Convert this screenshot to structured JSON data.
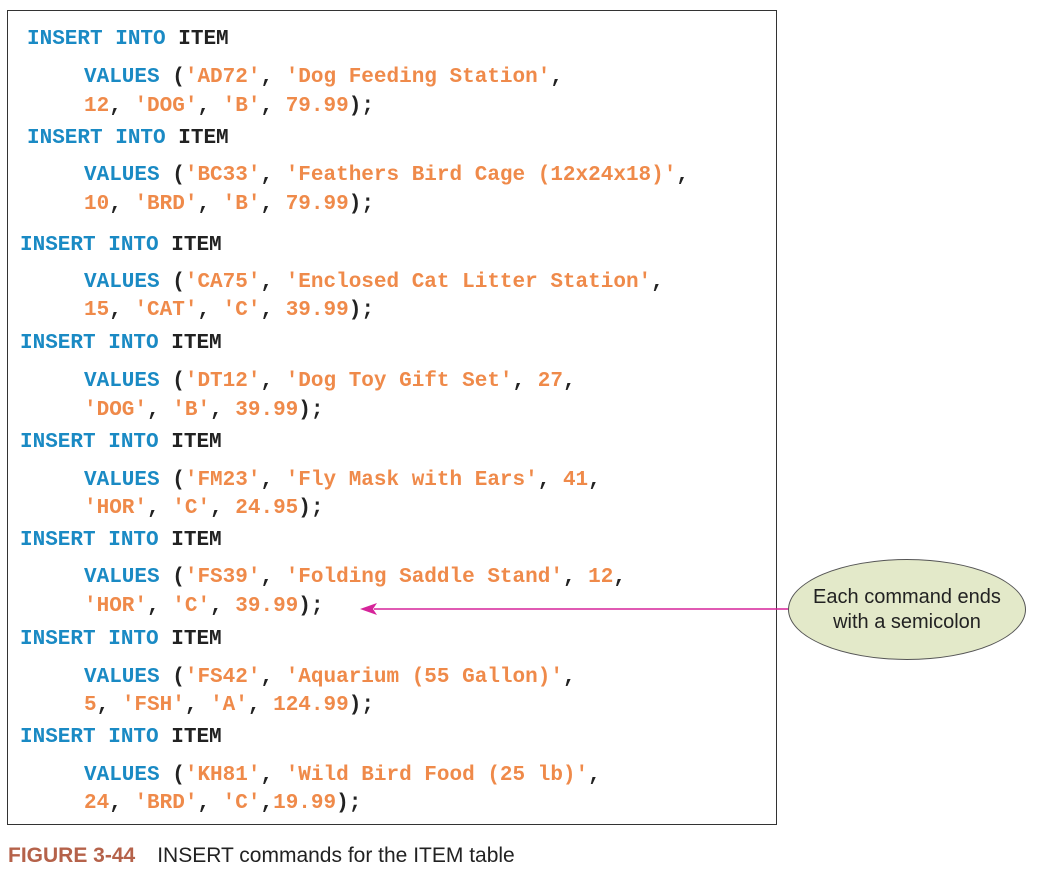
{
  "lines": [
    [
      [
        "kw",
        "INSERT INTO"
      ],
      [
        "pn",
        " "
      ],
      [
        "tbl",
        "ITEM"
      ]
    ],
    [
      [
        "kw",
        "VALUES"
      ],
      [
        "pn",
        " ("
      ],
      [
        "val",
        "'AD72'"
      ],
      [
        "pn",
        ", "
      ],
      [
        "val",
        "'Dog Feeding Station'"
      ],
      [
        "pn",
        ","
      ]
    ],
    [
      [
        "val",
        "12"
      ],
      [
        "pn",
        ", "
      ],
      [
        "val",
        "'DOG'"
      ],
      [
        "pn",
        ", "
      ],
      [
        "val",
        "'B'"
      ],
      [
        "pn",
        ", "
      ],
      [
        "val",
        "79.99"
      ],
      [
        "pn",
        ");"
      ]
    ],
    [
      [
        "kw",
        "INSERT INTO"
      ],
      [
        "pn",
        " "
      ],
      [
        "tbl",
        "ITEM"
      ]
    ],
    [
      [
        "kw",
        "VALUES"
      ],
      [
        "pn",
        " ("
      ],
      [
        "val",
        "'BC33'"
      ],
      [
        "pn",
        ", "
      ],
      [
        "val",
        "'Feathers Bird Cage (12x24x18)'"
      ],
      [
        "pn",
        ","
      ]
    ],
    [
      [
        "val",
        "10"
      ],
      [
        "pn",
        ", "
      ],
      [
        "val",
        "'BRD'"
      ],
      [
        "pn",
        ", "
      ],
      [
        "val",
        "'B'"
      ],
      [
        "pn",
        ", "
      ],
      [
        "val",
        "79.99"
      ],
      [
        "pn",
        ");"
      ]
    ],
    [
      [
        "kw",
        "INSERT INTO"
      ],
      [
        "pn",
        " "
      ],
      [
        "tbl",
        "ITEM"
      ]
    ],
    [
      [
        "kw",
        "VALUES"
      ],
      [
        "pn",
        " ("
      ],
      [
        "val",
        "'CA75'"
      ],
      [
        "pn",
        ", "
      ],
      [
        "val",
        "'Enclosed Cat Litter Station'"
      ],
      [
        "pn",
        ","
      ]
    ],
    [
      [
        "val",
        "15"
      ],
      [
        "pn",
        ", "
      ],
      [
        "val",
        "'CAT'"
      ],
      [
        "pn",
        ", "
      ],
      [
        "val",
        "'C'"
      ],
      [
        "pn",
        ", "
      ],
      [
        "val",
        "39.99"
      ],
      [
        "pn",
        ");"
      ]
    ],
    [
      [
        "kw",
        "INSERT INTO"
      ],
      [
        "pn",
        " "
      ],
      [
        "tbl",
        "ITEM"
      ]
    ],
    [
      [
        "kw",
        "VALUES"
      ],
      [
        "pn",
        " ("
      ],
      [
        "val",
        "'DT12'"
      ],
      [
        "pn",
        ", "
      ],
      [
        "val",
        "'Dog Toy Gift Set'"
      ],
      [
        "pn",
        ", "
      ],
      [
        "val",
        "27"
      ],
      [
        "pn",
        ","
      ]
    ],
    [
      [
        "val",
        "'DOG'"
      ],
      [
        "pn",
        ", "
      ],
      [
        "val",
        "'B'"
      ],
      [
        "pn",
        ", "
      ],
      [
        "val",
        "39.99"
      ],
      [
        "pn",
        ");"
      ]
    ],
    [
      [
        "kw",
        "INSERT INTO"
      ],
      [
        "pn",
        " "
      ],
      [
        "tbl",
        "ITEM"
      ]
    ],
    [
      [
        "kw",
        "VALUES"
      ],
      [
        "pn",
        " ("
      ],
      [
        "val",
        "'FM23'"
      ],
      [
        "pn",
        ", "
      ],
      [
        "val",
        "'Fly Mask with Ears'"
      ],
      [
        "pn",
        ", "
      ],
      [
        "val",
        "41"
      ],
      [
        "pn",
        ","
      ]
    ],
    [
      [
        "val",
        "'HOR'"
      ],
      [
        "pn",
        ", "
      ],
      [
        "val",
        "'C'"
      ],
      [
        "pn",
        ", "
      ],
      [
        "val",
        "24.95"
      ],
      [
        "pn",
        ");"
      ]
    ],
    [
      [
        "kw",
        "INSERT INTO"
      ],
      [
        "pn",
        " "
      ],
      [
        "tbl",
        "ITEM"
      ]
    ],
    [
      [
        "kw",
        "VALUES"
      ],
      [
        "pn",
        " ("
      ],
      [
        "val",
        "'FS39'"
      ],
      [
        "pn",
        ", "
      ],
      [
        "val",
        "'Folding Saddle Stand'"
      ],
      [
        "pn",
        ", "
      ],
      [
        "val",
        "12"
      ],
      [
        "pn",
        ","
      ]
    ],
    [
      [
        "val",
        "'HOR'"
      ],
      [
        "pn",
        ", "
      ],
      [
        "val",
        "'C'"
      ],
      [
        "pn",
        ", "
      ],
      [
        "val",
        "39.99"
      ],
      [
        "pn",
        ");"
      ]
    ],
    [
      [
        "kw",
        "INSERT INTO"
      ],
      [
        "pn",
        " "
      ],
      [
        "tbl",
        "ITEM"
      ]
    ],
    [
      [
        "kw",
        "VALUES"
      ],
      [
        "pn",
        " ("
      ],
      [
        "val",
        "'FS42'"
      ],
      [
        "pn",
        ", "
      ],
      [
        "val",
        "'Aquarium (55 Gallon)'"
      ],
      [
        "pn",
        ","
      ]
    ],
    [
      [
        "val",
        "5"
      ],
      [
        "pn",
        ", "
      ],
      [
        "val",
        "'FSH'"
      ],
      [
        "pn",
        ", "
      ],
      [
        "val",
        "'A'"
      ],
      [
        "pn",
        ", "
      ],
      [
        "val",
        "124.99"
      ],
      [
        "pn",
        ");"
      ]
    ],
    [
      [
        "kw",
        "INSERT INTO"
      ],
      [
        "pn",
        " "
      ],
      [
        "tbl",
        "ITEM"
      ]
    ],
    [
      [
        "kw",
        "VALUES"
      ],
      [
        "pn",
        " ("
      ],
      [
        "val",
        "'KH81'"
      ],
      [
        "pn",
        ", "
      ],
      [
        "val",
        "'Wild Bird Food (25 lb)'"
      ],
      [
        "pn",
        ","
      ]
    ],
    [
      [
        "val",
        "24"
      ],
      [
        "pn",
        ", "
      ],
      [
        "val",
        "'BRD'"
      ],
      [
        "pn",
        ", "
      ],
      [
        "val",
        "'C'"
      ],
      [
        "pn",
        ","
      ],
      [
        "val",
        "19.99"
      ],
      [
        "pn",
        ");"
      ]
    ]
  ],
  "callout": {
    "text": "Each command ends with a semicolon"
  },
  "caption": {
    "label": "FIGURE 3-44",
    "text": "INSERT commands for the ITEM table"
  },
  "colors": {
    "keyword": "#1a8ac4",
    "value": "#ef8a4a",
    "table": "#222222",
    "arrow": "#d6249a",
    "callout_fill": "#e3e9c9",
    "caption_label": "#b5624a"
  }
}
